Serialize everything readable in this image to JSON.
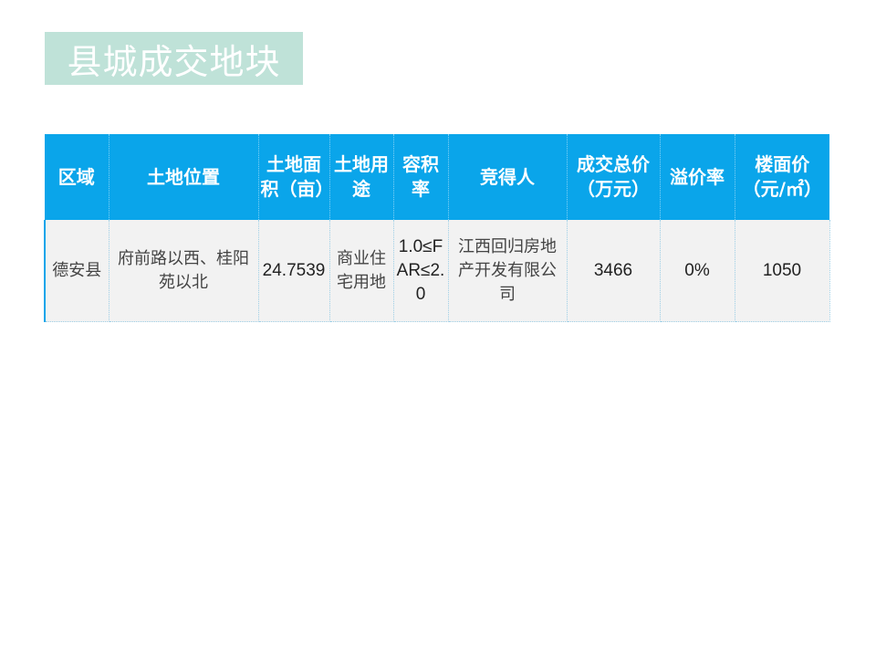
{
  "title": "县城成交地块",
  "colors": {
    "header_bg": "#0aa5ea",
    "title_bg": "#bfe2d8",
    "row_bg": "#f2f2f2"
  },
  "table": {
    "headers": [
      "区域",
      "土地位置",
      "土地面积（亩）",
      "土地用途",
      "容积率",
      "竞得人",
      "成交总价（万元）",
      "溢价率",
      "楼面价（元/㎡）"
    ],
    "rows": [
      [
        "德安县",
        "府前路以西、桂阳苑以北",
        "24.7539",
        "商业住宅用地",
        "1.0≤FAR≤2.0",
        "江西回归房地产开发有限公司",
        "3466",
        "0%",
        "1050"
      ]
    ]
  }
}
